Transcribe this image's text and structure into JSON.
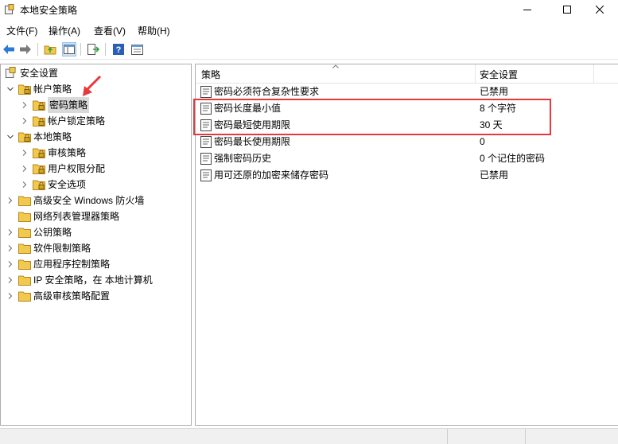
{
  "window": {
    "title": "本地安全策略"
  },
  "menu": [
    "文件(F)",
    "操作(A)",
    "查看(V)",
    "帮助(H)"
  ],
  "tree": {
    "root": "安全设置",
    "items": [
      {
        "label": "帐户策略",
        "level": 1,
        "expanded": true
      },
      {
        "label": "密码策略",
        "level": 2,
        "selected": true
      },
      {
        "label": "帐户锁定策略",
        "level": 2
      },
      {
        "label": "本地策略",
        "level": 1,
        "expanded": true
      },
      {
        "label": "审核策略",
        "level": 2
      },
      {
        "label": "用户权限分配",
        "level": 2
      },
      {
        "label": "安全选项",
        "level": 2
      },
      {
        "label": "高级安全 Windows 防火墙",
        "level": 1
      },
      {
        "label": "网络列表管理器策略",
        "level": 1
      },
      {
        "label": "公钥策略",
        "level": 1
      },
      {
        "label": "软件限制策略",
        "level": 1
      },
      {
        "label": "应用程序控制策略",
        "level": 1
      },
      {
        "label": "IP 安全策略，在 本地计算机",
        "level": 1
      },
      {
        "label": "高级审核策略配置",
        "level": 1
      }
    ]
  },
  "list": {
    "columns": {
      "policy": "策略",
      "setting": "安全设置"
    },
    "rows": [
      {
        "policy": "密码必须符合复杂性要求",
        "setting": "已禁用"
      },
      {
        "policy": "密码长度最小值",
        "setting": "8 个字符"
      },
      {
        "policy": "密码最短使用期限",
        "setting": "30 天"
      },
      {
        "policy": "密码最长使用期限",
        "setting": "0"
      },
      {
        "policy": "强制密码历史",
        "setting": "0 个记住的密码"
      },
      {
        "policy": "用可还原的加密来储存密码",
        "setting": "已禁用"
      }
    ]
  },
  "colors": {
    "highlight": "#e8383d",
    "arrow": "#e8383d",
    "selection": "#d9d9d9",
    "folder": "#f2c94c"
  }
}
